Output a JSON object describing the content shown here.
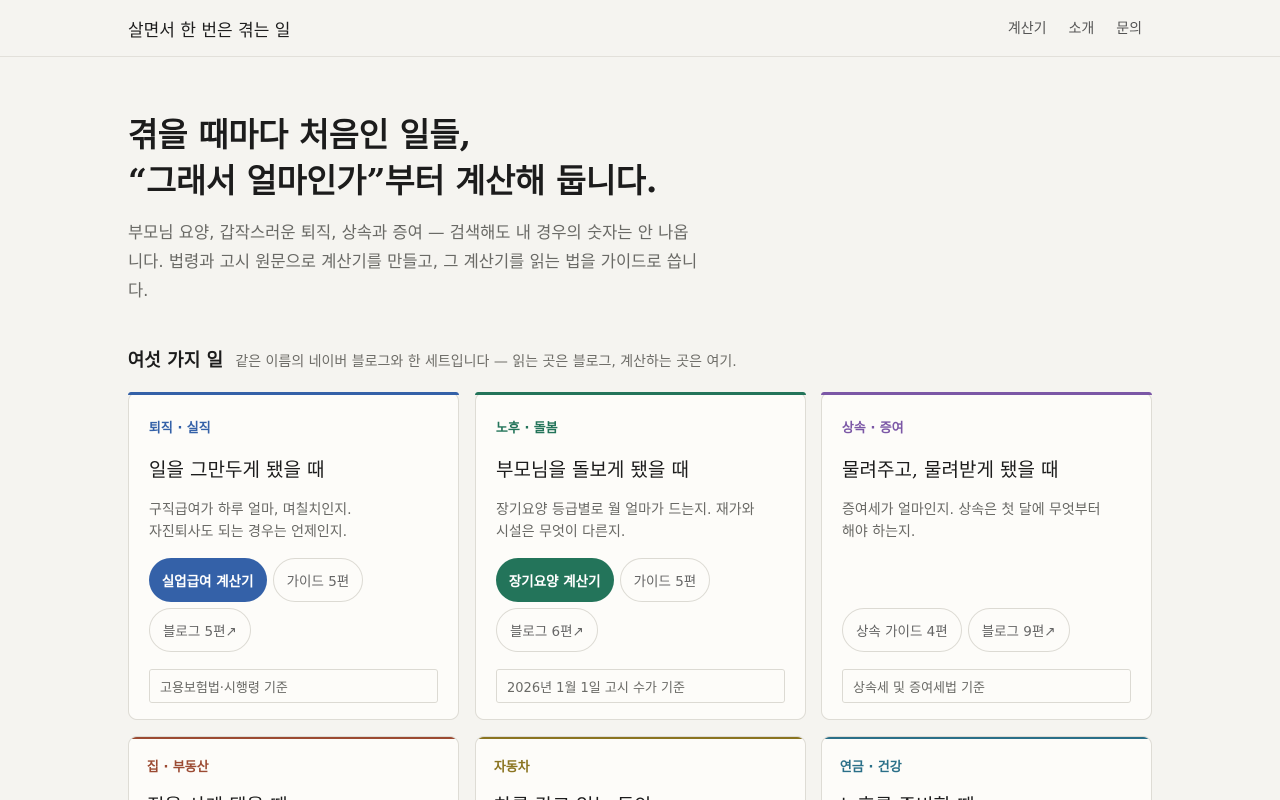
{
  "header": {
    "brand": "살면서 한 번은 겪는 일",
    "nav": [
      "계산기",
      "소개",
      "문의"
    ]
  },
  "hero": {
    "title_line1": "겪을 때마다 처음인 일들,",
    "title_line2": "“그래서 얼마인가”부터 계산해 둡니다.",
    "description": "부모님 요양, 갑작스러운 퇴직, 상속과 증여 — 검색해도 내 경우의 숫자는 안 나옵니다. 법령과 고시 원문으로 계산기를 만들고, 그 계산기를 읽는 법을 가이드로 씁니다."
  },
  "section": {
    "title": "여섯 가지 일",
    "subtitle": "같은 이름의 네이버 블로그와 한 세트입니다 — 읽는 곳은 블로그, 계산하는 곳은 여기."
  },
  "cards": [
    {
      "category": "퇴직 · 실직",
      "title": "일을 그만두게 됐을 때",
      "desc_line1": "구직급여가 하루 얼마, 며칠치인지.",
      "desc_line2": "자진퇴사도 되는 경우는 언제인지.",
      "primary": "실업급여 계산기",
      "ghost1": "가이드 5편",
      "ghost2": "블로그 5편↗",
      "basis": "고용보험법·시행령 기준",
      "color": "#3461a8"
    },
    {
      "category": "노후 · 돌봄",
      "title": "부모님을 돌보게 됐을 때",
      "desc_line1": "장기요양 등급별로 월 얼마가 드는지. 재가와",
      "desc_line2": "시설은 무엇이 다른지.",
      "primary": "장기요양 계산기",
      "ghost1": "가이드 5편",
      "ghost2": "블로그 6편↗",
      "basis": "2026년 1월 1일 고시 수가 기준",
      "color": "#23745a"
    },
    {
      "category": "상속 · 증여",
      "title": "물려주고, 물려받게 됐을 때",
      "desc_line1": "증여세가 얼마인지. 상속은 첫 달에 무엇부터",
      "desc_line2": "해야 하는지.",
      "ghost1": "상속 가이드 4편",
      "ghost2": "블로그 9편↗",
      "basis": "상속세 및 증여세법 기준",
      "color": "#7b57a6"
    }
  ],
  "cards_bottom": [
    {
      "category": "집 · 부동산",
      "title": "집을 사게 됐을 때",
      "color": "#9b4a32"
    },
    {
      "category": "자동차",
      "title": "차를 갖고 있는 동안",
      "color": "#8a7420"
    },
    {
      "category": "연금 · 건강",
      "title": "노후를 준비할 때",
      "color": "#2a6f88"
    }
  ]
}
